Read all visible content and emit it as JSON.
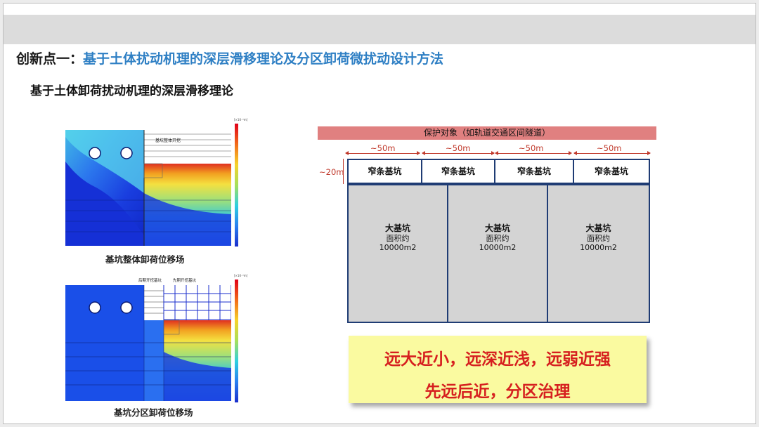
{
  "slide": {
    "title_prefix": "创新点一：",
    "title_main": "基于土体扰动机理的深层滑移理论及分区卸荷微扰动设计方法",
    "subtitle": "基于土体卸荷扰动机理的深层滑移理论"
  },
  "figure_top": {
    "annotation": "基坑整体开挖",
    "caption": "基坑整体卸荷位移场",
    "colorbar_unit": "[×10⁻³m]"
  },
  "figure_bottom": {
    "annotation_left": "后期开挖基坑",
    "annotation_right": "先期开挖基坑",
    "caption": "基坑分区卸荷位移场",
    "colorbar_unit": "[×10⁻³m]"
  },
  "diagram": {
    "protect_label": "保护对象（如轨道交通区间隧道）",
    "width_labels": [
      "~50m",
      "~50m",
      "~50m",
      "~50m"
    ],
    "depth_label": "~20m",
    "narrow_pits": [
      "窄条基坑",
      "窄条基坑",
      "窄条基坑",
      "窄条基坑"
    ],
    "big_pits": [
      {
        "title": "大基坑",
        "line2": "面积约",
        "line3": "10000m2"
      },
      {
        "title": "大基坑",
        "line2": "面积约",
        "line3": "10000m2"
      },
      {
        "title": "大基坑",
        "line2": "面积约",
        "line3": "10000m2"
      }
    ]
  },
  "strategy": {
    "line1": "远大近小，远深近浅，远弱近强",
    "line2": "先远后近，分区治理"
  },
  "colors": {
    "title_blue": "#2e7fc4",
    "protect_bar": "#e08080",
    "dimension_red": "#c0392b",
    "pit_border": "#1f3c74",
    "big_pit_fill": "#d4d4d4",
    "strategy_bg": "#fafaa0",
    "strategy_text": "#d61f1f"
  }
}
